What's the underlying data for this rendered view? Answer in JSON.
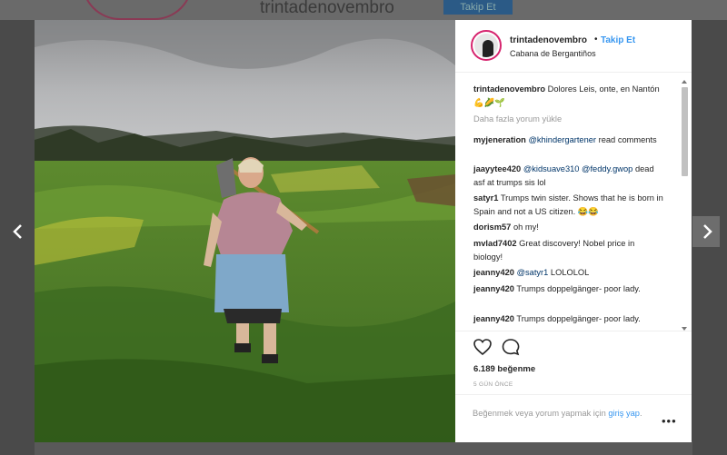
{
  "background": {
    "username": "trintadenovembro",
    "follow_label": "Takip Et"
  },
  "post": {
    "header": {
      "username": "trintadenovembro",
      "separator": "•",
      "follow_label": "Takip Et",
      "location": "Cabana de Bergantiños"
    },
    "caption": {
      "username": "trintadenovembro",
      "text": "Dolores Leis, onte, en Nantón 💪🌽🌱"
    },
    "load_more_label": "Daha fazla yorum yükle",
    "comments": [
      {
        "username": "myjeneration",
        "mention": "@khindergartener",
        "text": "read comments"
      },
      {
        "username": "jaayytee420",
        "mention": "@kidsuave310 @feddy.gwop",
        "text": "dead asf at trumps sis lol"
      },
      {
        "username": "satyr1",
        "mention": "",
        "text": "Trumps twin sister. Shows that he is born in Spain and not a US citizen. 😂😂"
      },
      {
        "username": "dorism57",
        "mention": "",
        "text": "oh my!"
      },
      {
        "username": "mvlad7402",
        "mention": "",
        "text": "Great discovery! Nobel price in biology!"
      },
      {
        "username": "jeanny420",
        "mention": "@satyr1",
        "text": "LOLOLOL"
      },
      {
        "username": "jeanny420",
        "mention": "",
        "text": "Trumps doppelgänger- poor lady."
      },
      {
        "username": "jeanny420",
        "mention": "",
        "text": "Trumps doppelgänger- poor lady."
      }
    ],
    "likes_label": "6.189 beğenme",
    "time_label": "5 GÜN ÖNCE",
    "login_prompt": "Beğenmek veya yorum yapmak için",
    "login_link": "giriş yap",
    "login_suffix": ".",
    "more_options": "•••"
  },
  "nav": {
    "prev_glyph": "‹",
    "next_glyph": "›"
  },
  "icons": [
    "heart-icon",
    "comment-icon",
    "chevron-left-icon",
    "chevron-right-icon",
    "more-options-icon"
  ],
  "colors": {
    "link": "#3897f0",
    "text": "#262626",
    "muted": "#999999",
    "overlay": "#4a4a4a"
  }
}
